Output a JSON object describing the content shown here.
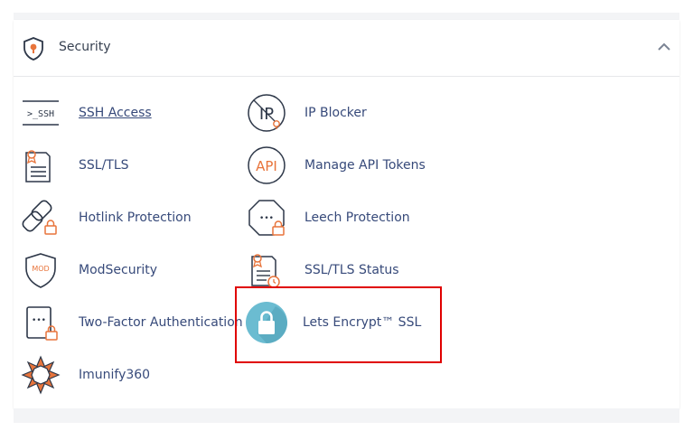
{
  "section": {
    "title": "Security",
    "collapse_icon": "chevron-up-icon",
    "header_icon": "shield-icon"
  },
  "items": [
    {
      "label": "SSH Access",
      "icon": "ssh-terminal-icon",
      "underlined": true
    },
    {
      "label": "SSL/TLS",
      "icon": "certificate-icon"
    },
    {
      "label": "Hotlink Protection",
      "icon": "hotlink-chain-lock-icon"
    },
    {
      "label": "ModSecurity",
      "icon": "modsecurity-shield-icon"
    },
    {
      "label": "Two-Factor Authentication",
      "icon": "two-factor-auth-icon"
    },
    {
      "label": "Imunify360",
      "icon": "imunify360-icon"
    },
    {
      "label": "IP Blocker",
      "icon": "ip-blocker-icon"
    },
    {
      "label": "Manage API Tokens",
      "icon": "api-tokens-icon"
    },
    {
      "label": "Leech Protection",
      "icon": "leech-protection-icon"
    },
    {
      "label": "SSL/TLS Status",
      "icon": "ssl-status-icon"
    },
    {
      "label": "Lets Encrypt™ SSL",
      "icon": "lets-encrypt-lock-icon"
    }
  ],
  "colors": {
    "accent_orange": "#e8743b",
    "label_blue": "#374a7a",
    "icon_dark": "#2d3748",
    "lets_encrypt_teal": "#6bbcd1",
    "highlight_red": "#e00000"
  },
  "icon_texts": {
    "ssh": ">_SSH",
    "ip": "IP",
    "api": "API",
    "mod": "MOD",
    "dots": "•••"
  }
}
